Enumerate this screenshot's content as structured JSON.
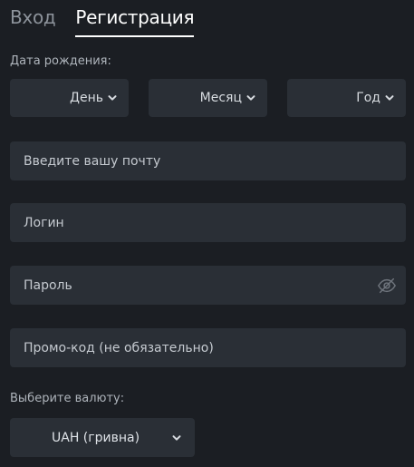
{
  "tabs": {
    "login": "Вход",
    "register": "Регистрация"
  },
  "birthdate": {
    "label": "Дата рождения:",
    "day": "День",
    "month": "Месяц",
    "year": "Год"
  },
  "fields": {
    "email_placeholder": "Введите вашу почту",
    "login_placeholder": "Логин",
    "password_placeholder": "Пароль",
    "promo_placeholder": "Промо-код (не обязательно)"
  },
  "currency": {
    "label": "Выберите валюту:",
    "selected": "UAH (гривна)"
  },
  "icons": {
    "chevron": "chevron-down-icon",
    "password_toggle": "eye-off-icon"
  },
  "colors": {
    "background": "#1b1e23",
    "field": "#2a2f36",
    "active_tab": "#ffffff",
    "inactive_tab": "#8d939b"
  }
}
